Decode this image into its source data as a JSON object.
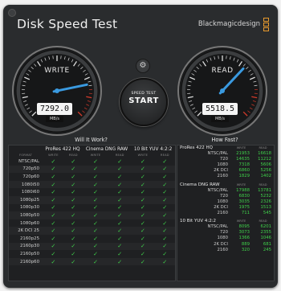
{
  "app": {
    "title": "Disk Speed Test",
    "brand": "Blackmagicdesign"
  },
  "colors": {
    "accent": "#3a9ae0",
    "ok": "#3fd14a",
    "redzone": "#d23a2a",
    "brand_orange": "#e89a2c"
  },
  "write_gauge": {
    "label": "WRITE",
    "value": "7292.0",
    "unit": "MB/s",
    "needle_fraction": 0.79
  },
  "read_gauge": {
    "label": "READ",
    "value": "5518.5",
    "unit": "MB/s",
    "needle_fraction": 0.66
  },
  "settings_icon": "gear-icon",
  "start_button": {
    "small_label": "SPEED TEST",
    "big_label": "START"
  },
  "will_it_work": {
    "title": "Will It Work?",
    "format_header": "FORMAT",
    "write_header": "WRITE",
    "read_header": "READ",
    "codecs": [
      "ProRes 422 HQ",
      "Cinema DNG RAW",
      "10 Bit YUV 4:2:2"
    ],
    "rows": [
      "NTSC/PAL",
      "720p50",
      "720p60",
      "1080i50",
      "1080i60",
      "1080p25",
      "1080p30",
      "1080p50",
      "1080p60",
      "2K DCI 25",
      "2160p25",
      "2160p30",
      "2160p50",
      "2160p60"
    ],
    "check_symbol": "✓"
  },
  "how_fast": {
    "title": "How Fast?",
    "write_header": "WRITE",
    "read_header": "READ",
    "groups": [
      {
        "name": "ProRes 422 HQ",
        "rows": [
          {
            "label": "NTSC/PAL",
            "write": "21953",
            "read": "16618"
          },
          {
            "label": "720",
            "write": "14635",
            "read": "11212"
          },
          {
            "label": "1080",
            "write": "7318",
            "read": "5606"
          },
          {
            "label": "2K DCI",
            "write": "6860",
            "read": "5256"
          },
          {
            "label": "2160",
            "write": "1829",
            "read": "1402"
          }
        ]
      },
      {
        "name": "Cinema DNG RAW",
        "rows": [
          {
            "label": "NTSC/PAL",
            "write": "17988",
            "read": "13781"
          },
          {
            "label": "720",
            "write": "6830",
            "read": "5232"
          },
          {
            "label": "1080",
            "write": "3035",
            "read": "2326"
          },
          {
            "label": "2K DCI",
            "write": "1975",
            "read": "1513"
          },
          {
            "label": "2160",
            "write": "711",
            "read": "545"
          }
        ]
      },
      {
        "name": "10 Bit YUV 4:2:2",
        "rows": [
          {
            "label": "NTSC/PAL",
            "write": "8095",
            "read": "6201"
          },
          {
            "label": "720",
            "write": "3073",
            "read": "2355"
          },
          {
            "label": "1080",
            "write": "1366",
            "read": "1046"
          },
          {
            "label": "2K DCI",
            "write": "889",
            "read": "681"
          },
          {
            "label": "2160",
            "write": "320",
            "read": "245"
          }
        ]
      }
    ]
  }
}
